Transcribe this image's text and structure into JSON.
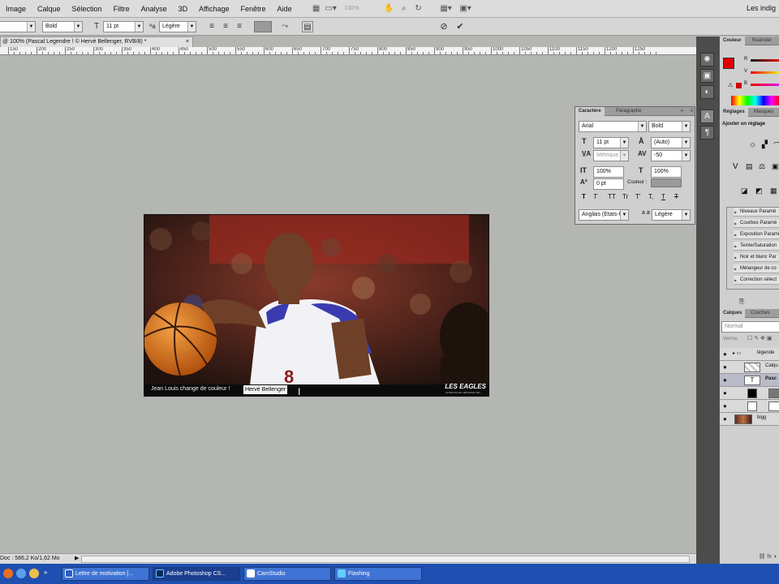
{
  "menubar": {
    "items": [
      "Image",
      "Calque",
      "Sélection",
      "Filtre",
      "Analyse",
      "3D",
      "Affichage",
      "Fenêtre",
      "Aide"
    ],
    "zoom": "100%",
    "workspace": "Les indig"
  },
  "options": {
    "font_style": "Bold",
    "font_size": "11 pt",
    "antialias": "Légère",
    "cancel_icon": "cancel-circle-icon",
    "commit_icon": "check-icon"
  },
  "document": {
    "tab_title": "@ 100% (Pascal Legendre ! © Hervé Bellenger, RVB/8) *",
    "close": "×",
    "ruler_labels": [
      "150",
      "200",
      "250",
      "300",
      "350",
      "400",
      "450",
      "500",
      "550",
      "600",
      "650",
      "700",
      "750",
      "800",
      "850",
      "900",
      "950",
      "1000",
      "1050",
      "1100",
      "1150",
      "1200",
      "1250"
    ],
    "caption_text": "Jean Louis change de couleur !",
    "caption_selected": "Hervé Bellenger",
    "logo": "LES EAGLES",
    "logo_sub": "ENTENTE DE LIBOURNE ORT...",
    "status": "Doc : 586,2 Ko/1,62 Mo"
  },
  "character_panel": {
    "tabs": [
      "Caractère",
      "Paragraphe"
    ],
    "font_family": "Arial",
    "font_style": "Bold",
    "size": "11 pt",
    "leading": "(Auto)",
    "kerning": "Métrique",
    "tracking": "-50",
    "vscale": "100%",
    "hscale": "100%",
    "baseline": "0 pt",
    "color_label": "Couleur :",
    "language": "Anglais (Etats-U...",
    "antialias_prefix": "a a",
    "antialias": "Légère",
    "style_buttons": [
      "T",
      "T",
      "TT",
      "Tr",
      "T'",
      "T,",
      "T",
      "T"
    ]
  },
  "color_panel": {
    "tabs": [
      "Couleur",
      "Nuancier"
    ],
    "channels": [
      "R",
      "V",
      "B"
    ]
  },
  "adjust_panel": {
    "tabs": [
      "Réglages",
      "Masques"
    ],
    "title": "Ajouter un réglage",
    "presets": [
      "Niveaux Paramè",
      "Courbes Paramè",
      "Exposition Parame",
      "Teinte/Saturation",
      "Noir et blanc Par",
      "Mélangeur de co",
      "Correction sélect"
    ]
  },
  "layers_panel": {
    "tabs": [
      "Calques",
      "Couches"
    ],
    "blend": "Normal",
    "lock_label": "Verrou",
    "layers": [
      "légende",
      "Calqu",
      "Pasc",
      "",
      "",
      "bigg"
    ]
  },
  "taskbar": {
    "tasks": [
      "Lettre de motivation [...",
      "Adobe Photoshop CS...",
      "CamStudio",
      "Flashing"
    ]
  },
  "colors": {
    "foreground": "#e00000",
    "background": "#ffffff",
    "panel": "#cfcfcf",
    "taskbar": "#1f4fb0"
  }
}
